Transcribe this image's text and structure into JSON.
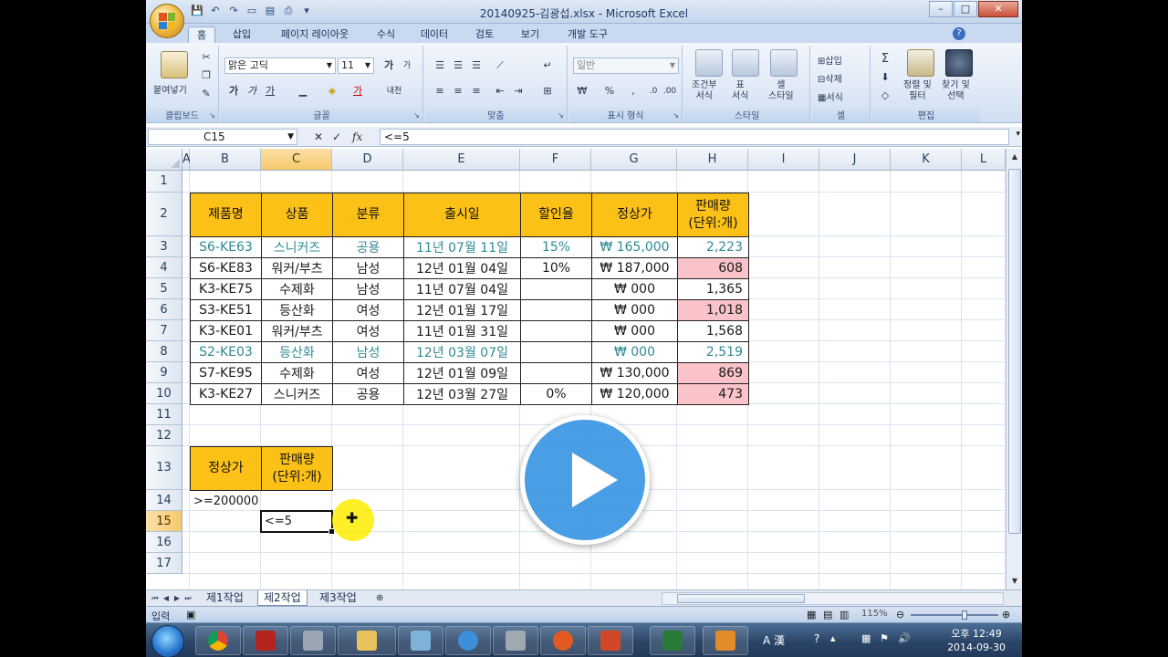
{
  "window": {
    "title": "20140925-김광섭.xlsx - Microsoft Excel",
    "buttons": [
      "–",
      "□",
      "✕"
    ]
  },
  "tabs": [
    "홈",
    "삽입",
    "페이지 레이아웃",
    "수식",
    "데이터",
    "검토",
    "보기",
    "개발 도구"
  ],
  "ribbon": {
    "clipboard": {
      "label": "클립보드",
      "paste": "붙여넣기"
    },
    "font": {
      "label": "글꼴",
      "font_name": "맑은 고딕",
      "font_size": "11",
      "bold": "가",
      "italic": "가",
      "underline": "가",
      "grow": "가",
      "shrink": "가",
      "font_color": "가",
      "phonetic": "내천"
    },
    "alignment": {
      "label": "맞춤"
    },
    "number": {
      "label": "표시 형식",
      "format": "일반",
      "currency": "₩",
      "percent": "%"
    },
    "styles": {
      "label": "스타일",
      "cond": "조건부\n서식",
      "table": "표\n서식",
      "cell": "셀\n스타일"
    },
    "cells": {
      "label": "셀",
      "insert": "삽입",
      "delete": "삭제",
      "format": "서식"
    },
    "editing": {
      "label": "편집",
      "sum": "Σ",
      "sort": "정렬 및\n필터",
      "find": "찾기 및\n선택"
    }
  },
  "formula_bar": {
    "name_box": "C15",
    "fx": "fx",
    "value": "<=5"
  },
  "columns": [
    "A",
    "B",
    "C",
    "D",
    "E",
    "F",
    "G",
    "H",
    "I",
    "J",
    "K",
    "L"
  ],
  "rows": [
    "1",
    "2",
    "3",
    "4",
    "5",
    "6",
    "7",
    "8",
    "9",
    "10",
    "11",
    "12",
    "13",
    "14",
    "15",
    "16",
    "17"
  ],
  "table": {
    "headers": [
      "제품명",
      "상품",
      "분류",
      "출시일",
      "할인율",
      "정상가",
      "판매량\n(단위:개)"
    ],
    "rows": [
      {
        "cells": [
          "S6-KE63",
          "스니커즈",
          "공용",
          "11년 07월 11일",
          "15%",
          "₩ 165,000",
          "2,223"
        ],
        "teal": true,
        "pink": false
      },
      {
        "cells": [
          "S6-KE83",
          "워커/부츠",
          "남성",
          "12년 01월 04일",
          "10%",
          "₩ 187,000",
          "608"
        ],
        "teal": false,
        "pink": true
      },
      {
        "cells": [
          "K3-KE75",
          "수제화",
          "남성",
          "11년 07월 04일",
          "",
          "₩ 000",
          "1,365"
        ],
        "teal": false,
        "pink": false
      },
      {
        "cells": [
          "S3-KE51",
          "등산화",
          "여성",
          "12년 01월 17일",
          "",
          "₩ 000",
          "1,018"
        ],
        "teal": false,
        "pink": true
      },
      {
        "cells": [
          "K3-KE01",
          "워커/부츠",
          "여성",
          "11년 01월 31일",
          "",
          "₩ 000",
          "1,568"
        ],
        "teal": false,
        "pink": false
      },
      {
        "cells": [
          "S2-KE03",
          "등산화",
          "남성",
          "12년 03월 07일",
          "",
          "₩ 000",
          "2,519"
        ],
        "teal": true,
        "pink": false
      },
      {
        "cells": [
          "S7-KE95",
          "수제화",
          "여성",
          "12년 01월 09일",
          "",
          "₩ 130,000",
          "869"
        ],
        "teal": false,
        "pink": true
      },
      {
        "cells": [
          "K3-KE27",
          "스니커즈",
          "공용",
          "12년 03월 27일",
          "0%",
          "₩ 120,000",
          "473"
        ],
        "teal": false,
        "pink": true
      }
    ]
  },
  "criteria": {
    "headers": [
      "정상가",
      "판매량\n(단위:개)"
    ],
    "b14": ">=200000",
    "c15": "<=5"
  },
  "sheets": [
    "제1작업",
    "제2작업",
    "제3작업"
  ],
  "active_sheet": "제2작업",
  "status": {
    "mode": "입력",
    "zoom": "115%"
  },
  "taskbar": {
    "time": "오후 12:49",
    "date": "2014-09-30",
    "lang": "A 漢"
  },
  "colors": {
    "header_fill": "#fcc117",
    "pink_fill": "#f9c3c9",
    "teal_text": "#2f8a94",
    "play_blue": "#3996e3"
  }
}
